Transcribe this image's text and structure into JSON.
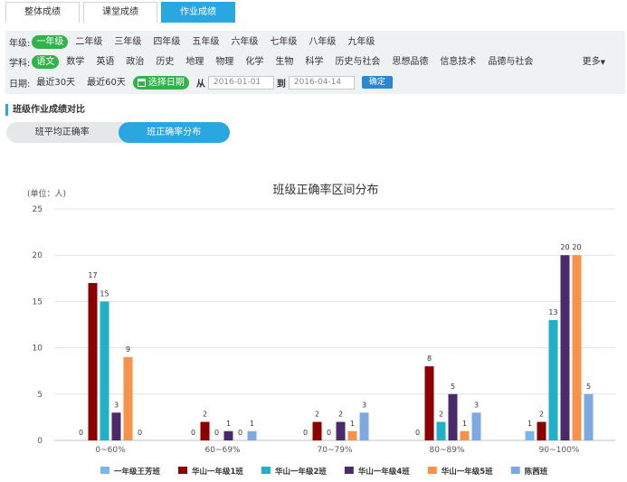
{
  "tabs": [
    "整体成绩",
    "课堂成绩",
    "作业成绩"
  ],
  "active_tab": 2,
  "filters": {
    "grade_label": "年级:",
    "grades": [
      "一年级",
      "二年级",
      "三年级",
      "四年级",
      "五年级",
      "六年级",
      "七年级",
      "八年级",
      "九年级"
    ],
    "subject_label": "学科:",
    "subjects": [
      "语文",
      "数学",
      "英语",
      "政治",
      "历史",
      "地理",
      "物理",
      "化学",
      "生物",
      "科学",
      "历史与社会",
      "思想品德",
      "信息技术",
      "品德与社会"
    ],
    "more_label": "更多",
    "date_label": "日期:",
    "recent30": "最近30天",
    "recent60": "最近60天",
    "choose_date": "选择日期",
    "from_label": "从",
    "from_date": "2016-01-01",
    "to_label": "到",
    "to_date": "2016-04-14",
    "confirm_label": "确定"
  },
  "section_title": "班级作业成绩对比",
  "toggle": [
    "班平均正确率",
    "班正确率分布"
  ],
  "toggle_active": 1,
  "colors": {
    "accent": "#2aa6e0",
    "selected_green": "#2fb34a",
    "confirm_blue": "#2b87d1"
  },
  "chart_data": {
    "type": "bar",
    "title": "班级正确率区间分布",
    "unit_label": "(单位：人)",
    "categories": [
      "0~60%",
      "60~69%",
      "70~79%",
      "80~89%",
      "90~100%"
    ],
    "ylim": [
      0,
      25
    ],
    "yticks": [
      0,
      5,
      10,
      15,
      20,
      25
    ],
    "grid": true,
    "legend_position": "bottom",
    "series": [
      {
        "name": "一年级王芳班",
        "color": "#7cb5ec",
        "values": [
          0,
          0,
          0,
          0,
          1
        ]
      },
      {
        "name": "华山一年级1班",
        "color": "#8b0000",
        "values": [
          17,
          2,
          2,
          8,
          2
        ]
      },
      {
        "name": "华山一年级2班",
        "color": "#20b0c8",
        "values": [
          15,
          0,
          0,
          2,
          13
        ]
      },
      {
        "name": "华山一年级4班",
        "color": "#4b2a6b",
        "values": [
          3,
          1,
          2,
          5,
          20
        ]
      },
      {
        "name": "华山一年级5班",
        "color": "#f7924a",
        "values": [
          9,
          0,
          1,
          1,
          20
        ]
      },
      {
        "name": "陈茜班",
        "color": "#7ea8e0",
        "values": [
          0,
          1,
          3,
          3,
          5
        ]
      }
    ]
  }
}
